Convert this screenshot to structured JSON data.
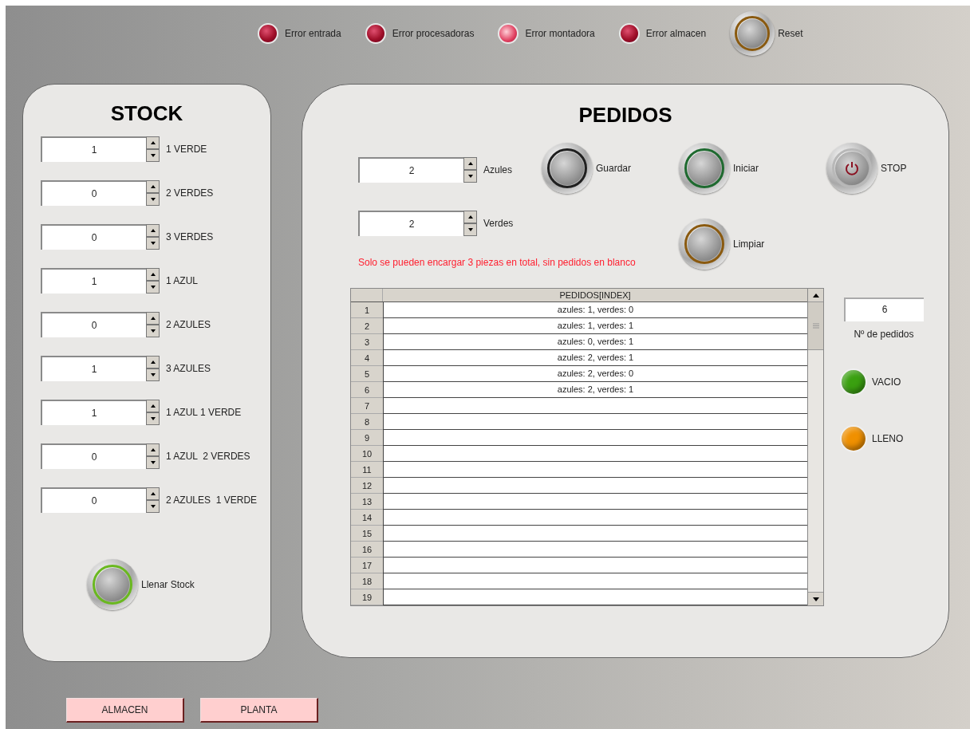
{
  "error_indicators": [
    {
      "label": "Error entrada",
      "on": false
    },
    {
      "label": "Error procesadoras",
      "on": false
    },
    {
      "label": "Error montadora",
      "on": true
    },
    {
      "label": "Error almacen",
      "on": false
    }
  ],
  "reset_button": {
    "label": "Reset",
    "color": "#8a5a10"
  },
  "stock": {
    "title": "STOCK",
    "items": [
      {
        "value": "1",
        "label": "1 VERDE"
      },
      {
        "value": "0",
        "label": "2 VERDES"
      },
      {
        "value": "0",
        "label": "3 VERDES"
      },
      {
        "value": "1",
        "label": "1 AZUL"
      },
      {
        "value": "0",
        "label": "2 AZULES"
      },
      {
        "value": "1",
        "label": "3 AZULES"
      },
      {
        "value": "1",
        "label": "1 AZUL 1 VERDE"
      },
      {
        "value": "0",
        "label": "1 AZUL  2 VERDES"
      },
      {
        "value": "0",
        "label": "2 AZULES  1 VERDE"
      }
    ],
    "fill_button": {
      "label": "Llenar Stock",
      "color": "#6ab820"
    }
  },
  "pedidos": {
    "title": "PEDIDOS",
    "inputs": [
      {
        "value": "2",
        "label": "Azules"
      },
      {
        "value": "2",
        "label": "Verdes"
      }
    ],
    "buttons": [
      {
        "label": "Guardar",
        "kind": "ring",
        "color": "#202020"
      },
      {
        "label": "Iniciar",
        "kind": "ring",
        "color": "#1f6a30"
      },
      {
        "label": "STOP",
        "kind": "power",
        "color": "#b8b8b8"
      },
      {
        "label": "Limpiar",
        "kind": "ring",
        "color": "#8a5a10"
      }
    ],
    "message": "Solo se pueden encargar 3 piezas en total, sin pedidos en blanco",
    "table": {
      "column": "PEDIDOS[INDEX]",
      "rows": [
        {
          "index": "1",
          "value": "azules: 1, verdes: 0"
        },
        {
          "index": "2",
          "value": "azules: 1, verdes: 1"
        },
        {
          "index": "3",
          "value": "azules: 0, verdes: 1"
        },
        {
          "index": "4",
          "value": "azules: 2, verdes: 1"
        },
        {
          "index": "5",
          "value": "azules: 2, verdes: 0"
        },
        {
          "index": "6",
          "value": "azules: 2, verdes: 1"
        },
        {
          "index": "7"
        },
        {
          "index": "8"
        },
        {
          "index": "9"
        },
        {
          "index": "10"
        },
        {
          "index": "11"
        },
        {
          "index": "12"
        },
        {
          "index": "13"
        },
        {
          "index": "14"
        },
        {
          "index": "15"
        },
        {
          "index": "16"
        },
        {
          "index": "17"
        },
        {
          "index": "18"
        },
        {
          "index": "19"
        }
      ]
    },
    "count": {
      "value": "6",
      "label": "Nº de pedidos"
    },
    "indicators": [
      {
        "label": "VACIO",
        "color": "#3aa010",
        "on": true
      },
      {
        "label": "LLENO",
        "color": "#f09000",
        "on": true
      }
    ]
  },
  "nav_buttons": [
    "ALMACEN",
    "PLANTA"
  ]
}
